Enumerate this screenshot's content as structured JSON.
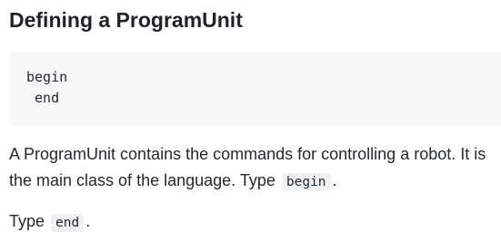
{
  "heading": "Defining a ProgramUnit",
  "code_block": {
    "lines": [
      "begin",
      " end"
    ]
  },
  "paragraph1": {
    "line1": "A ProgramUnit contains the commands for controlling a robot. It is",
    "line2_text": "the main class of the language. Type ",
    "line2_code": "begin",
    "line2_end": "."
  },
  "paragraph2": {
    "text": "Type ",
    "code": "end",
    "end": "."
  }
}
